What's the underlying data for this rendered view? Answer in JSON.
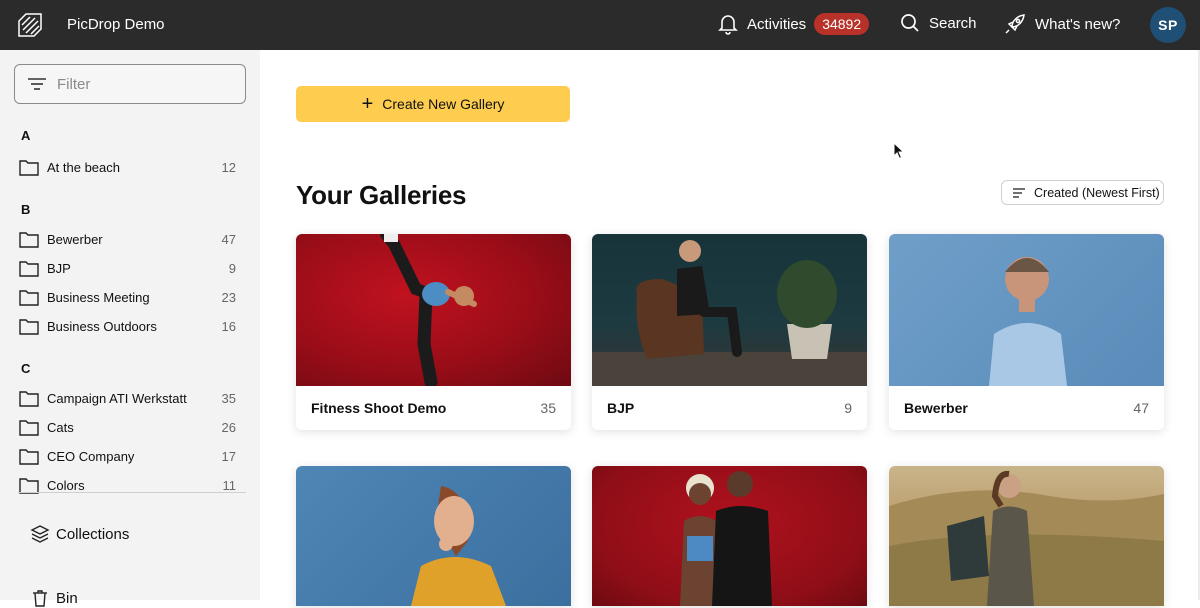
{
  "app": {
    "title": "PicDrop Demo"
  },
  "topbar": {
    "activities_label": "Activities",
    "activities_count": "34892",
    "search_label": "Search",
    "whatsnew_label": "What's new?",
    "avatar_initials": "SP"
  },
  "sidebar": {
    "filter_placeholder": "Filter",
    "groups": [
      {
        "letter": "A",
        "items": [
          {
            "label": "At the beach",
            "count": "12"
          }
        ]
      },
      {
        "letter": "B",
        "items": [
          {
            "label": "Bewerber",
            "count": "47"
          },
          {
            "label": "BJP",
            "count": "9"
          },
          {
            "label": "Business Meeting",
            "count": "23"
          },
          {
            "label": "Business Outdoors",
            "count": "16"
          }
        ]
      },
      {
        "letter": "C",
        "items": [
          {
            "label": "Campaign ATI Werkstatt",
            "count": "35"
          },
          {
            "label": "Cats",
            "count": "26"
          },
          {
            "label": "CEO Company",
            "count": "17"
          },
          {
            "label": "Colors",
            "count": "11"
          }
        ]
      }
    ],
    "collections_label": "Collections",
    "bin_label": "Bin"
  },
  "main": {
    "create_button_label": "Create New Gallery",
    "section_title": "Your Galleries",
    "sort_label": "Created (Newest First)",
    "cards": [
      {
        "name": "Fitness Shoot Demo",
        "count": "35"
      },
      {
        "name": "BJP",
        "count": "9"
      },
      {
        "name": "Bewerber",
        "count": "47"
      }
    ]
  },
  "colors": {
    "topbar": "#2b2b2b",
    "accent_button": "#fecd4f",
    "badge": "#b8322a",
    "avatar": "#1f4f74"
  }
}
